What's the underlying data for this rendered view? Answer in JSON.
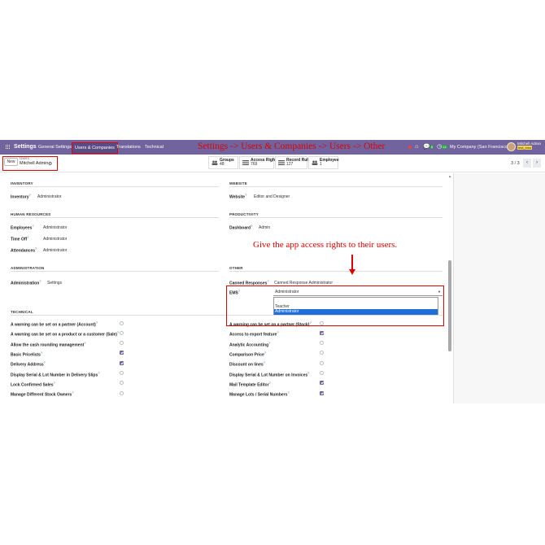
{
  "navbar": {
    "app_name": "Settings",
    "menu": [
      "General Settings",
      "Users & Companies",
      "Translations",
      "Technical"
    ],
    "annotation": "Settings -> Users & Companies -> Users -> Other",
    "chat_badge": "5",
    "clock_badge": "14",
    "company": "My Company (San Francisco)",
    "user_name": "Mitchell Admin",
    "db_name": "test_ems"
  },
  "control": {
    "new_label": "New",
    "breadcrumb_parent": "Users",
    "breadcrumb_current": "Mitchell Admin",
    "stats": [
      {
        "label": "Groups",
        "value": "48"
      },
      {
        "label": "Access Rights",
        "value": "769"
      },
      {
        "label": "Record Rules",
        "value": "127"
      },
      {
        "label": "Employee",
        "value": "1"
      }
    ],
    "pager": "3 / 3"
  },
  "form": {
    "sections": {
      "inventory": "INVENTORY",
      "website": "WEBSITE",
      "human_resources": "HUMAN RESOURCES",
      "productivity": "PRODUCTIVITY",
      "administration": "ADMINISTRATION",
      "other": "OTHER",
      "technical": "TECHNICAL"
    },
    "inventory": {
      "label": "Inventory",
      "value": "Administrator"
    },
    "website": {
      "label": "Website",
      "value": "Editor and Designer"
    },
    "hr": [
      {
        "label": "Employees",
        "value": "Administrator"
      },
      {
        "label": "Time Off",
        "value": "Administrator"
      },
      {
        "label": "Attendances",
        "value": "Administrator"
      }
    ],
    "productivity": {
      "label": "Dashboard",
      "value": "Admin"
    },
    "administration": {
      "label": "Administration",
      "value": "Settings"
    },
    "other": {
      "canned": {
        "label": "Canned Responses",
        "value": "Canned Response Administrator"
      },
      "ems": {
        "label": "EMS",
        "value": "Administrator",
        "options": [
          "Teacher",
          "Administrator"
        ]
      }
    },
    "annotation": "Give the app access rights to their users.",
    "technical_left": [
      {
        "label": "A warning can be set on a partner (Account)",
        "checked": false
      },
      {
        "label": "A warning can be set on a product or a customer (Sale)",
        "checked": false
      },
      {
        "label": "Allow the cash rounding management",
        "checked": false
      },
      {
        "label": "Basic Pricelists",
        "checked": true
      },
      {
        "label": "Delivery Address",
        "checked": true
      },
      {
        "label": "Display Serial & Lot Number in Delivery Slips",
        "checked": false
      },
      {
        "label": "Lock Confirmed Sales",
        "checked": false
      },
      {
        "label": "Manage Different Stock Owners",
        "checked": false
      }
    ],
    "technical_right": [
      {
        "label": "A warning can be set on a partner (Stock)",
        "checked": false
      },
      {
        "label": "Access to export feature",
        "checked": true
      },
      {
        "label": "Analytic Accounting",
        "checked": false
      },
      {
        "label": "Comparison Price",
        "checked": false
      },
      {
        "label": "Discount on lines",
        "checked": false
      },
      {
        "label": "Display Serial & Lot Number on Invoices",
        "checked": false
      },
      {
        "label": "Mail Template Editor",
        "checked": true
      },
      {
        "label": "Manage Lots / Serial Numbers",
        "checked": true
      }
    ]
  }
}
